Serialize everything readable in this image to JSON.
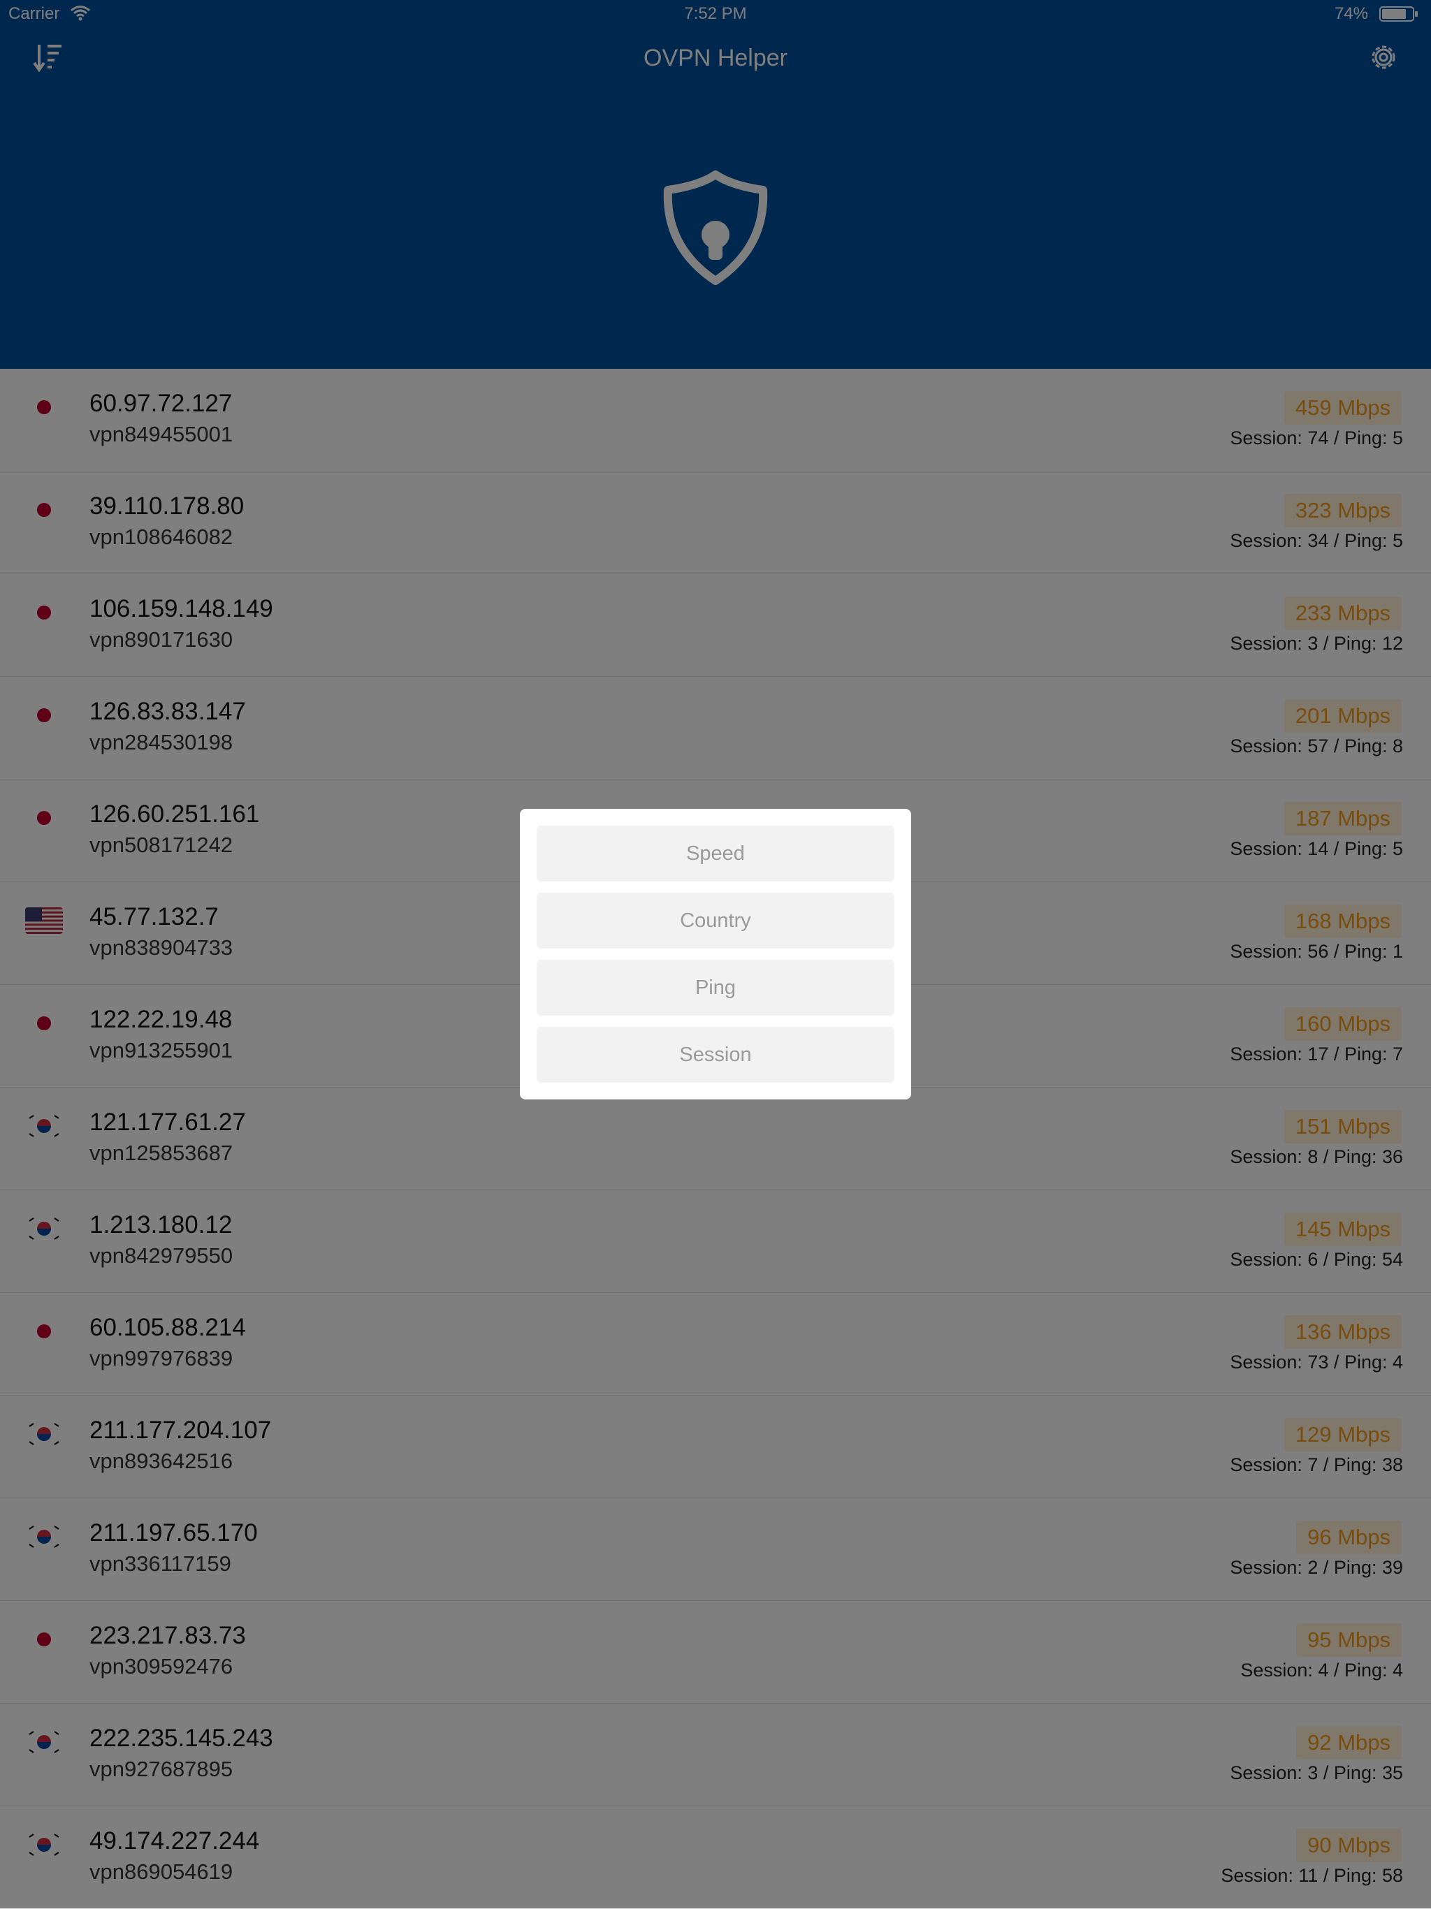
{
  "status": {
    "carrier": "Carrier",
    "time": "7:52 PM",
    "battery": "74%"
  },
  "header": {
    "title": "OVPN Helper"
  },
  "icons": {
    "sort": "sort-descending-icon",
    "settings": "gear-icon",
    "shield": "shield-lock-icon",
    "wifi": "wifi-icon",
    "battery": "battery-icon"
  },
  "colors": {
    "header_bg": "#00519c",
    "speed_text": "#f39a1b",
    "speed_bg": "#fff0d6"
  },
  "servers": [
    {
      "country": "JP",
      "ip": "60.97.72.127",
      "host": "vpn849455001",
      "speed": "459 Mbps",
      "meta": "Session: 74 / Ping: 5"
    },
    {
      "country": "JP",
      "ip": "39.110.178.80",
      "host": "vpn108646082",
      "speed": "323 Mbps",
      "meta": "Session: 34 / Ping: 5"
    },
    {
      "country": "JP",
      "ip": "106.159.148.149",
      "host": "vpn890171630",
      "speed": "233 Mbps",
      "meta": "Session: 3 / Ping: 12"
    },
    {
      "country": "JP",
      "ip": "126.83.83.147",
      "host": "vpn284530198",
      "speed": "201 Mbps",
      "meta": "Session: 57 / Ping: 8"
    },
    {
      "country": "JP",
      "ip": "126.60.251.161",
      "host": "vpn508171242",
      "speed": "187 Mbps",
      "meta": "Session: 14 / Ping: 5"
    },
    {
      "country": "US",
      "ip": "45.77.132.7",
      "host": "vpn838904733",
      "speed": "168 Mbps",
      "meta": "Session: 56 / Ping: 1"
    },
    {
      "country": "JP",
      "ip": "122.22.19.48",
      "host": "vpn913255901",
      "speed": "160 Mbps",
      "meta": "Session: 17 / Ping: 7"
    },
    {
      "country": "KR",
      "ip": "121.177.61.27",
      "host": "vpn125853687",
      "speed": "151 Mbps",
      "meta": "Session: 8 / Ping: 36"
    },
    {
      "country": "KR",
      "ip": "1.213.180.12",
      "host": "vpn842979550",
      "speed": "145 Mbps",
      "meta": "Session: 6 / Ping: 54"
    },
    {
      "country": "JP",
      "ip": "60.105.88.214",
      "host": "vpn997976839",
      "speed": "136 Mbps",
      "meta": "Session: 73 / Ping: 4"
    },
    {
      "country": "KR",
      "ip": "211.177.204.107",
      "host": "vpn893642516",
      "speed": "129 Mbps",
      "meta": "Session: 7 / Ping: 38"
    },
    {
      "country": "KR",
      "ip": "211.197.65.170",
      "host": "vpn336117159",
      "speed": "96 Mbps",
      "meta": "Session: 2 / Ping: 39"
    },
    {
      "country": "JP",
      "ip": "223.217.83.73",
      "host": "vpn309592476",
      "speed": "95 Mbps",
      "meta": "Session: 4 / Ping: 4"
    },
    {
      "country": "KR",
      "ip": "222.235.145.243",
      "host": "vpn927687895",
      "speed": "92 Mbps",
      "meta": "Session: 3 / Ping: 35"
    },
    {
      "country": "KR",
      "ip": "49.174.227.244",
      "host": "vpn869054619",
      "speed": "90 Mbps",
      "meta": "Session: 11 / Ping: 58"
    }
  ],
  "sort_menu": {
    "options": [
      "Speed",
      "Country",
      "Ping",
      "Session"
    ]
  }
}
